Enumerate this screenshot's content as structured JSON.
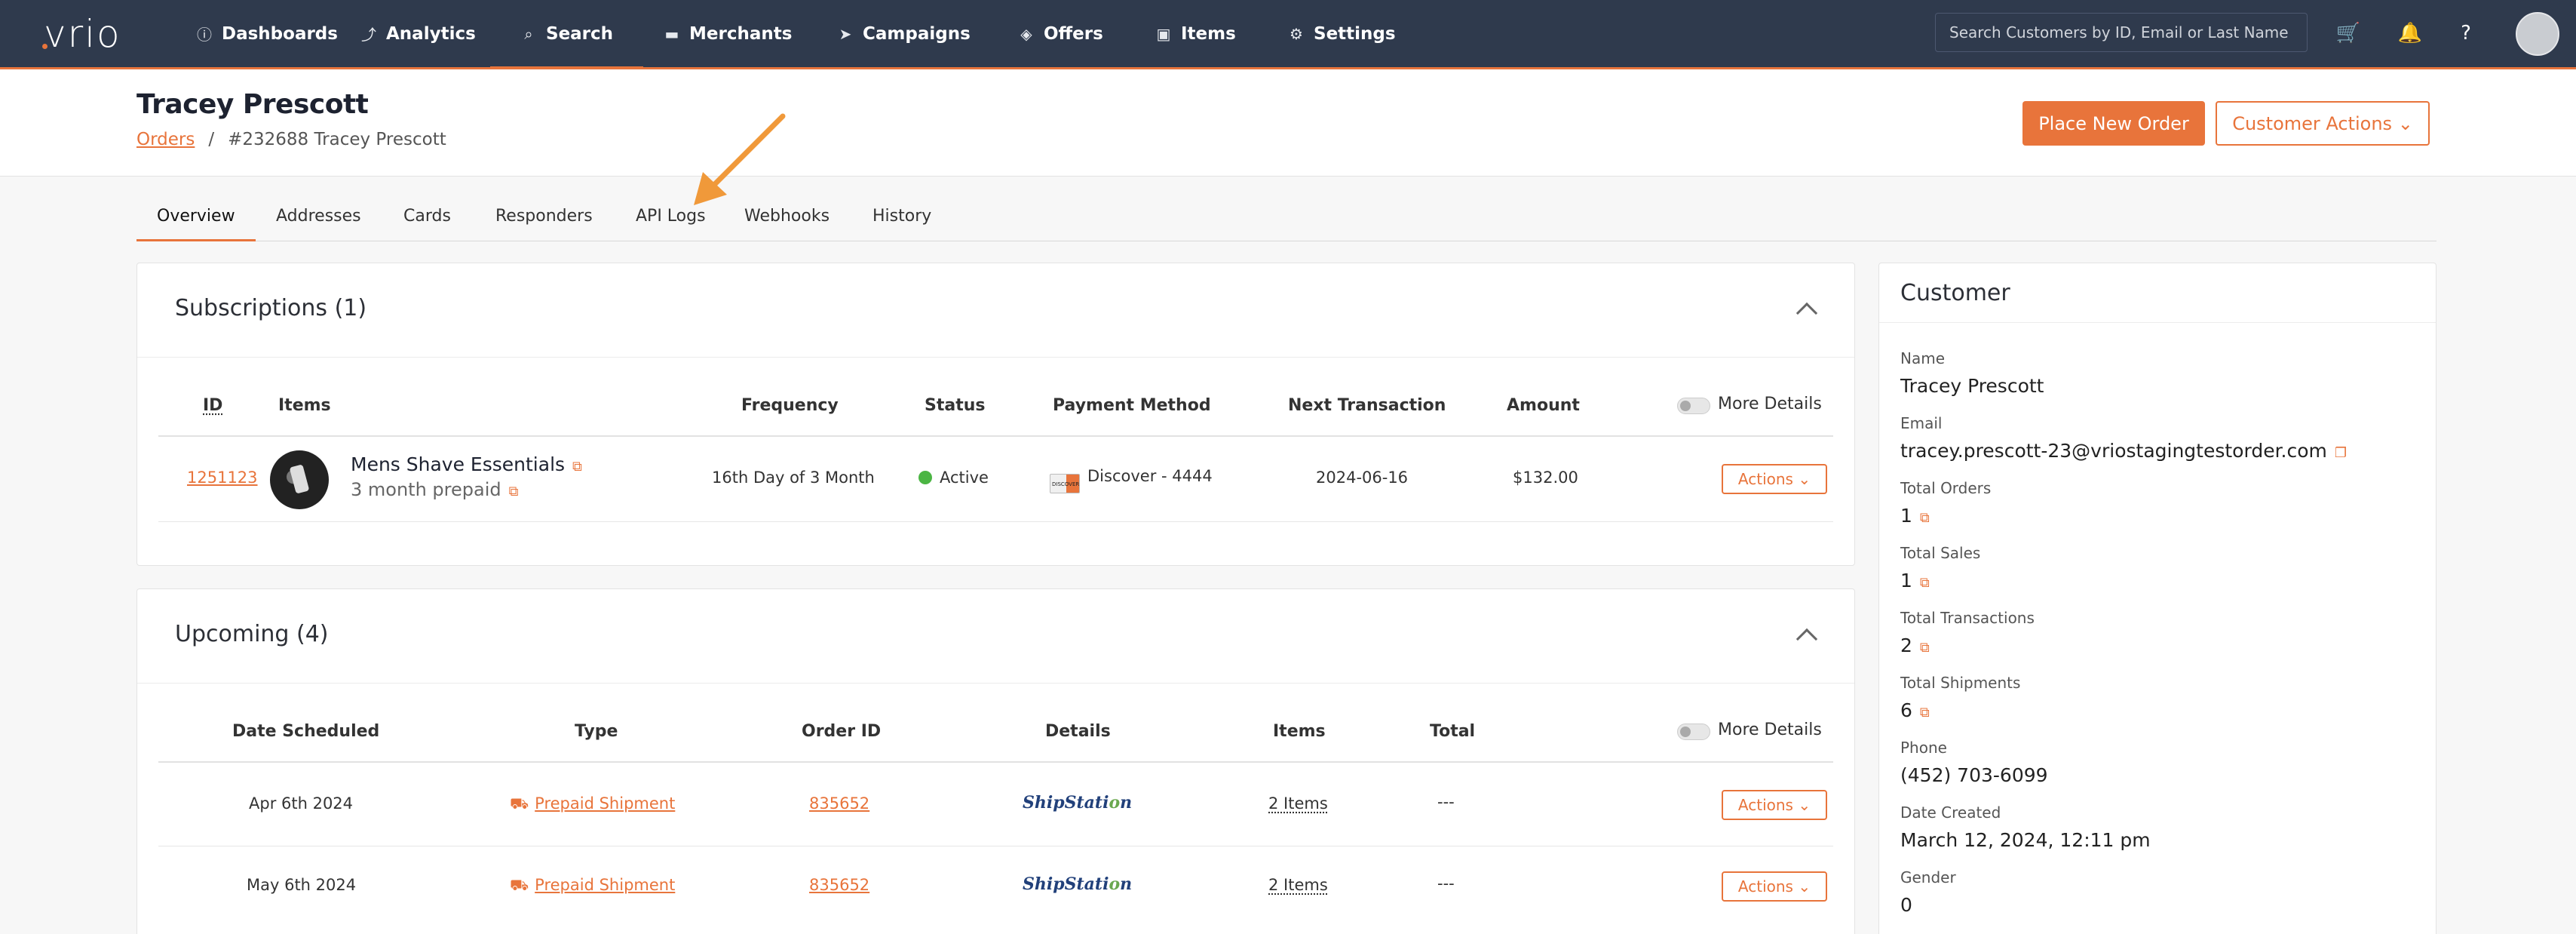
{
  "nav": {
    "logo": "vrio",
    "items": [
      {
        "label": "Dashboards",
        "icon": "ⓘ"
      },
      {
        "label": "Analytics",
        "icon": "⤴"
      },
      {
        "label": "Search",
        "icon": "⌕"
      },
      {
        "label": "Merchants",
        "icon": "▬"
      },
      {
        "label": "Campaigns",
        "icon": "➤"
      },
      {
        "label": "Offers",
        "icon": "◈"
      },
      {
        "label": "Items",
        "icon": "▣"
      },
      {
        "label": "Settings",
        "icon": "⚙"
      }
    ],
    "active": "Search",
    "search_placeholder": "Search Customers by ID, Email or Last Name"
  },
  "header": {
    "title": "Tracey Prescott",
    "breadcrumb_link": "Orders",
    "breadcrumb_sep": "/",
    "breadcrumb_current": "#232688 Tracey Prescott",
    "place_order": "Place New Order",
    "customer_actions": "Customer Actions ⌄"
  },
  "tabs": [
    "Overview",
    "Addresses",
    "Cards",
    "Responders",
    "API Logs",
    "Webhooks",
    "History"
  ],
  "subscriptions": {
    "title": "Subscriptions (1)",
    "more_details": "More Details",
    "headers": {
      "id": "ID",
      "items": "Items",
      "frequency": "Frequency",
      "status": "Status",
      "payment": "Payment Method",
      "next": "Next Transaction",
      "amount": "Amount"
    },
    "rows": [
      {
        "id": "1251123",
        "item_name": "Mens Shave Essentials",
        "item_plan": "3 month prepaid",
        "frequency": "16th Day of 3 Month",
        "status": "Active",
        "payment": "Discover - 4444",
        "card_brand": "DISCOVER",
        "next": "2024-06-16",
        "amount": "$132.00",
        "actions": "Actions ⌄"
      }
    ]
  },
  "upcoming": {
    "title": "Upcoming (4)",
    "more_details": "More Details",
    "headers": {
      "date": "Date Scheduled",
      "type": "Type",
      "order": "Order ID",
      "details": "Details",
      "items": "Items",
      "total": "Total"
    },
    "rows": [
      {
        "date": "Apr 6th 2024",
        "type": "Prepaid Shipment",
        "order": "835652",
        "details": "ShipStation",
        "items": "2 Items",
        "total": "---",
        "actions": "Actions ⌄"
      },
      {
        "date": "May 6th 2024",
        "type": "Prepaid Shipment",
        "order": "835652",
        "details": "ShipStation",
        "items": "2 Items",
        "total": "---",
        "actions": "Actions ⌄"
      }
    ]
  },
  "customer": {
    "title": "Customer",
    "fields": [
      {
        "label": "Name",
        "value": "Tracey Prescott"
      },
      {
        "label": "Email",
        "value": "tracey.prescott-23@vriostagingtestorder.com"
      },
      {
        "label": "Total Orders",
        "value": "1"
      },
      {
        "label": "Total Sales",
        "value": "1"
      },
      {
        "label": "Total Transactions",
        "value": "2"
      },
      {
        "label": "Total Shipments",
        "value": "6"
      },
      {
        "label": "Phone",
        "value": "(452) 703-6099"
      },
      {
        "label": "Date Created",
        "value": "March 12, 2024, 12:11 pm"
      },
      {
        "label": "Gender",
        "value": "0"
      }
    ]
  },
  "colors": {
    "accent": "#e8743b",
    "nav_bg": "#2f3a4d",
    "active_status": "#4bb543"
  }
}
